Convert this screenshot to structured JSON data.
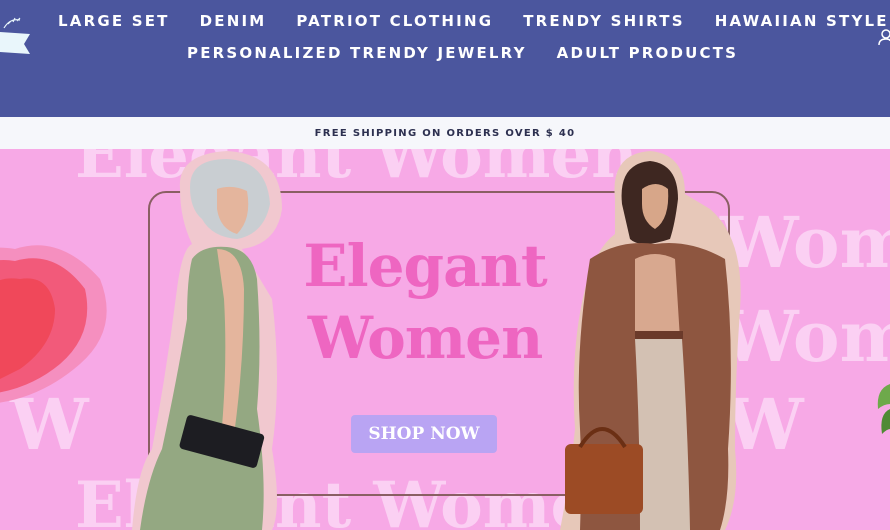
{
  "header": {
    "nav_row_1": [
      "LARGE SET",
      "DENIM",
      "PATRIOT CLOTHING",
      "TRENDY SHIRTS",
      "HAWAIIAN STYLE"
    ],
    "nav_row_2": [
      "PERSONALIZED TRENDY JEWELRY",
      "ADULT PRODUCTS"
    ],
    "icons": {
      "logo": "ribbon-logo-icon",
      "account": "user-account-icon"
    }
  },
  "announcement": {
    "text": "FREE SHIPPING ON ORDERS OVER $ 40"
  },
  "hero": {
    "background_text": [
      "Elegant Women",
      "Women",
      "Women",
      "W",
      "W",
      "Elegant Women"
    ],
    "title_line_1": "Elegant",
    "title_line_2": "Women",
    "button_label": "SHOP NOW"
  },
  "colors": {
    "header_bg": "#4b569e",
    "announce_bg": "#f6f7fb",
    "hero_bg": "#f7a9e6",
    "title": "#ee66c1",
    "button": "#b9a4f3"
  }
}
